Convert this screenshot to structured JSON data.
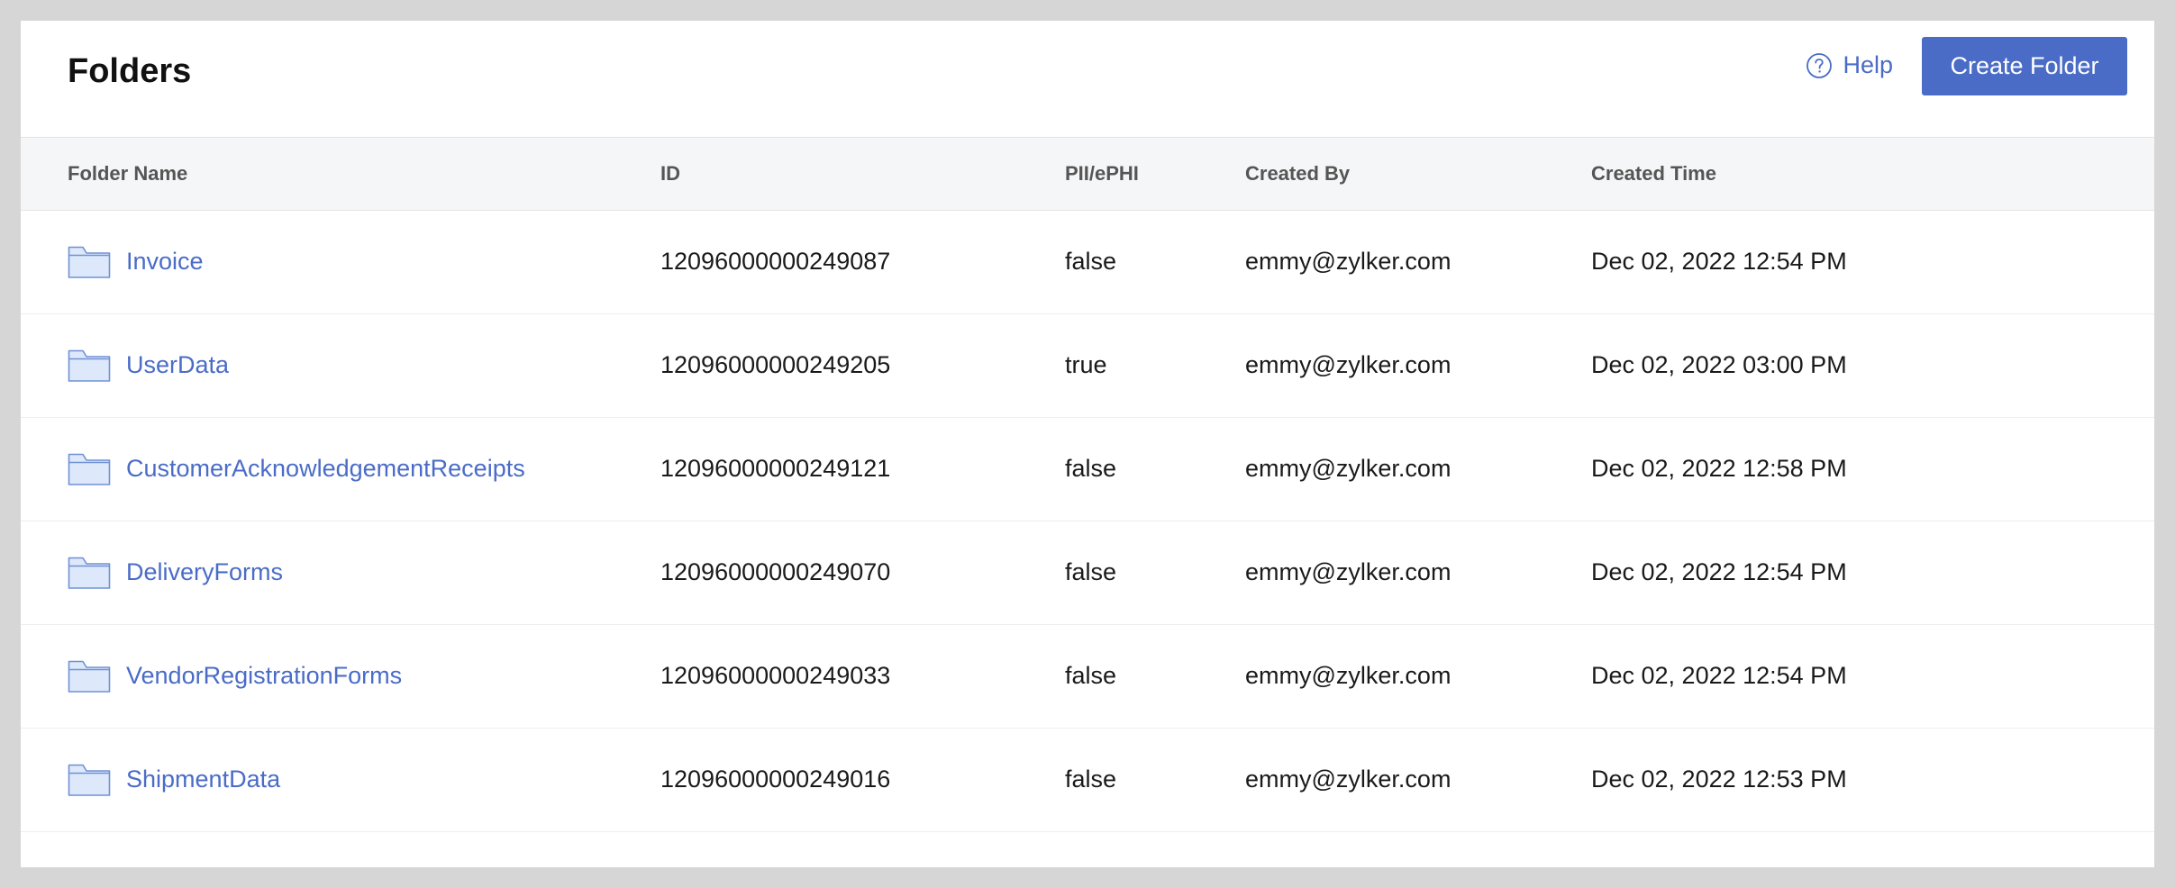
{
  "header": {
    "title": "Folders",
    "help_label": "Help",
    "help_icon": "question-circle-icon",
    "create_label": "Create Folder"
  },
  "colors": {
    "accent": "#4a6cc7",
    "folder_fill": "#dde8fa",
    "folder_stroke": "#6f91d6"
  },
  "table": {
    "columns": [
      "Folder Name",
      "ID",
      "PII/ePHI",
      "Created By",
      "Created Time"
    ],
    "rows": [
      {
        "name": "Invoice",
        "id": "12096000000249087",
        "pii": "false",
        "created_by": "emmy@zylker.com",
        "created_time": "Dec 02, 2022 12:54 PM"
      },
      {
        "name": "UserData",
        "id": "12096000000249205",
        "pii": "true",
        "created_by": "emmy@zylker.com",
        "created_time": "Dec 02, 2022 03:00 PM"
      },
      {
        "name": "CustomerAcknowledgementReceipts",
        "id": "12096000000249121",
        "pii": "false",
        "created_by": "emmy@zylker.com",
        "created_time": "Dec 02, 2022 12:58 PM"
      },
      {
        "name": "DeliveryForms",
        "id": "12096000000249070",
        "pii": "false",
        "created_by": "emmy@zylker.com",
        "created_time": "Dec 02, 2022 12:54 PM"
      },
      {
        "name": "VendorRegistrationForms",
        "id": "12096000000249033",
        "pii": "false",
        "created_by": "emmy@zylker.com",
        "created_time": "Dec 02, 2022 12:54 PM"
      },
      {
        "name": "ShipmentData",
        "id": "12096000000249016",
        "pii": "false",
        "created_by": "emmy@zylker.com",
        "created_time": "Dec 02, 2022 12:53 PM"
      }
    ]
  }
}
